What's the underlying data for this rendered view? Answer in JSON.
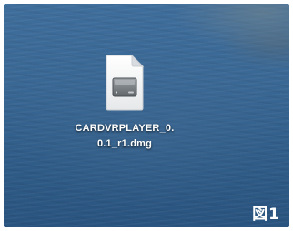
{
  "desktop": {
    "file": {
      "icon": "dmg-disk-image-icon",
      "name_line1": "CARDVRPLAYER_0.",
      "name_line2": "0.1_r1.dmg"
    }
  },
  "figure_label": "図1",
  "colors": {
    "desktop_sea": "#3a6895",
    "label_text": "#ffffff"
  }
}
